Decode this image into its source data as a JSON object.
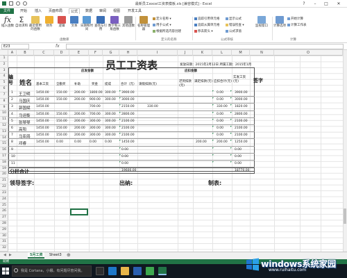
{
  "window": {
    "title": "最新员工excel工资表模板.xls  [兼容模式] - Excel",
    "minimize": "–",
    "restore": "□",
    "close": "✕",
    "help": "?"
  },
  "tabs": [
    "文件",
    "开始",
    "插入",
    "页面布局",
    "公式",
    "数据",
    "审阅",
    "视图",
    "开发工具"
  ],
  "active_tab": "公式",
  "ribbon": {
    "buttons": [
      {
        "label": "插入函数",
        "icon": "function-icon"
      },
      {
        "label": "自动求和",
        "icon": "sum-icon"
      },
      {
        "label": "最近使用的函数",
        "icon": "recent-icon"
      },
      {
        "label": "财务",
        "icon": "finance-icon"
      },
      {
        "label": "逻辑",
        "icon": "logic-icon"
      },
      {
        "label": "文本",
        "icon": "text-icon"
      },
      {
        "label": "日期和时间",
        "icon": "date-icon"
      },
      {
        "label": "查找与引用",
        "icon": "lookup-icon"
      },
      {
        "label": "数学和三角函数",
        "icon": "math-icon"
      },
      {
        "label": "其他函数",
        "icon": "more-icon"
      },
      {
        "label": "名称管理器",
        "icon": "name-manager-icon"
      }
    ],
    "name_items": [
      "定义名称 ▾",
      "用于公式 ▾",
      "根据所选内容创建"
    ],
    "audit_items": [
      "追踪引用单元格",
      "追踪从属单元格",
      "移去箭头 ▾",
      "显示公式",
      "错误检查 ▾",
      "公式求值"
    ],
    "watch": "监视窗口",
    "calc_options": "计算选项",
    "calc_items": [
      "开始计算",
      "计算工作表"
    ],
    "groups": [
      "函数库",
      "定义的名称",
      "公式审核",
      "计算"
    ]
  },
  "formula_bar": {
    "name_box": "E23",
    "fx": "fx"
  },
  "columns": [
    "A",
    "B",
    "C",
    "D",
    "E",
    "F",
    "G",
    "H",
    "I",
    "J",
    "K",
    "L",
    "M",
    "N",
    "O"
  ],
  "rows": [
    "1",
    "2",
    "3",
    "4",
    "5",
    "6",
    "7",
    "8",
    "9",
    "10",
    "11",
    "12",
    "13",
    "14",
    "15",
    "16",
    "17",
    "18",
    "19",
    "20",
    "21",
    "22",
    "23",
    "24",
    "25",
    "26",
    "27",
    "28",
    "29",
    "30",
    "31",
    "32"
  ],
  "payroll": {
    "title": "员工工资表",
    "issue_date": "发放日期：2015年2月12日 所属工期：2015年1月",
    "headers": {
      "seq": "编号",
      "name": "姓名",
      "payable_group": "应发金额",
      "deduct_group": "应扣金额",
      "base": "基本工资",
      "position": "全勤奖",
      "subsidy": "补助",
      "overtime": "奖金",
      "bonus": "提成",
      "total": "合计（元）",
      "personal_deduct": "请假扣款(元)",
      "late": "迟到扣款(元)",
      "social": "满足扣款(元)",
      "deduct_total": "应扣合计(元)",
      "actual": "实发工资(元)",
      "sign": "签字"
    },
    "rows": [
      {
        "no": "1",
        "name": "王卫明",
        "base": "1450.00",
        "pos": "150.00",
        "sub": "200.00",
        "ot": "1800.00",
        "bonus": "300.00",
        "total": "3900.00",
        "pd": "",
        "late": "",
        "soc": "",
        "dt": "0.00",
        "actual": "3900.00"
      },
      {
        "no": "2",
        "name": "马国庆",
        "base": "1450.00",
        "pos": "150.00",
        "sub": "200.00",
        "ot": "900.00",
        "bonus": "300.00",
        "total": "3000.00",
        "pd": "",
        "late": "",
        "soc": "",
        "dt": "0.00",
        "actual": "3000.00"
      },
      {
        "no": "3",
        "name": "郭国斌",
        "base": "1450.00",
        "pos": "",
        "sub": "",
        "ot": "700.00",
        "bonus": "",
        "total": "2150.00",
        "pd": "330.00",
        "late": "",
        "soc": "",
        "dt": "330.00",
        "actual": "1820.00"
      },
      {
        "no": "4",
        "name": "马运衡",
        "base": "1450.00",
        "pos": "150.00",
        "sub": "200.00",
        "ot": "700.00",
        "bonus": "300.00",
        "total": "2800.00",
        "pd": "",
        "late": "",
        "soc": "",
        "dt": "0.00",
        "actual": "2800.00"
      },
      {
        "no": "5",
        "name": "张琴琴",
        "base": "1450.00",
        "pos": "150.00",
        "sub": "200.00",
        "ot": "300.00",
        "bonus": "300.00",
        "total": "2100.00",
        "pd": "",
        "late": "",
        "soc": "",
        "dt": "0.00",
        "actual": "2100.00"
      },
      {
        "no": "6",
        "name": "高阳",
        "base": "1450.00",
        "pos": "150.00",
        "sub": "200.00",
        "ot": "300.00",
        "bonus": "300.00",
        "total": "2100.00",
        "pd": "",
        "late": "",
        "soc": "",
        "dt": "0.00",
        "actual": "2100.00"
      },
      {
        "no": "7",
        "name": "马亚鸽",
        "base": "1450.00",
        "pos": "150.00",
        "sub": "200.00",
        "ot": "300.00",
        "bonus": "300.00",
        "total": "2100.00",
        "pd": "",
        "late": "",
        "soc": "",
        "dt": "0.00",
        "actual": "2100.00"
      },
      {
        "no": "8",
        "name": "邓睿",
        "base": "1450.00",
        "pos": "0.00",
        "sub": "0.00",
        "ot": "0.00",
        "bonus": "0.00",
        "total": "1450.00",
        "pd": "",
        "late": "",
        "soc": "200.00",
        "dt": "200.00",
        "actual": "1250.00"
      },
      {
        "no": "9",
        "name": "",
        "base": "",
        "pos": "",
        "sub": "",
        "ot": "",
        "bonus": "",
        "total": "0.00",
        "pd": "",
        "late": "",
        "soc": "",
        "dt": "",
        "actual": "0.00"
      },
      {
        "no": "10",
        "name": "",
        "base": "",
        "pos": "",
        "sub": "",
        "ot": "",
        "bonus": "",
        "total": "0.00",
        "pd": "",
        "late": "",
        "soc": "",
        "dt": "",
        "actual": "0.00"
      },
      {
        "no": "11",
        "name": "",
        "base": "",
        "pos": "",
        "sub": "",
        "ot": "",
        "bonus": "",
        "total": "0.00",
        "pd": "",
        "late": "",
        "soc": "",
        "dt": "",
        "actual": "0.00"
      }
    ],
    "subtotal_label": "分栏合计",
    "subtotal_total": "19600.00",
    "subtotal_actual": "18770.00",
    "footer": {
      "leader": "领导签字:",
      "cashier": "出纳:",
      "maker": "制表:"
    }
  },
  "sheet_tabs": [
    "5月工资",
    "Sheet3"
  ],
  "status": {
    "ready": "就绪"
  },
  "taskbar": {
    "search": "我是 Cortana，小娜。有问题尽管问我。"
  },
  "watermark": {
    "brand": "windows系统家园",
    "url": "www.ruihaitu.com"
  },
  "colors": {
    "excel_green": "#217346",
    "taskbar": "#101820"
  }
}
